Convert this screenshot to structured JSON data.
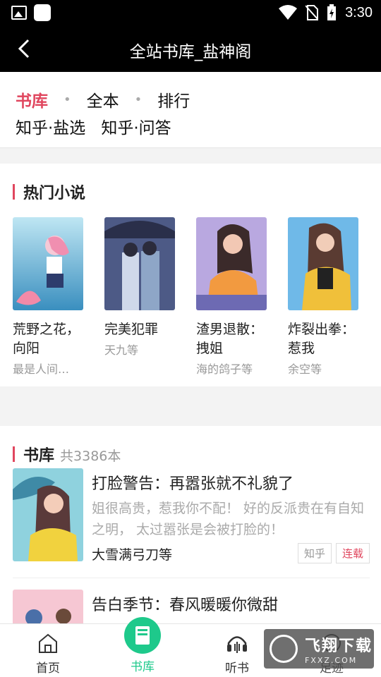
{
  "status_bar": {
    "time": "3:30",
    "icons": [
      "image-icon",
      "app-icon",
      "wifi-icon",
      "no-sim-icon",
      "battery-charging-icon"
    ]
  },
  "header": {
    "title": "全站书库_盐神阁",
    "back_icon": "chevron-left-icon"
  },
  "categories": {
    "row1": [
      "书库",
      "全本",
      "排行"
    ],
    "row2": [
      "知乎·盐选",
      "知乎·问答"
    ],
    "active": "书库",
    "accent": "#e0465e"
  },
  "hot": {
    "title": "热门小说",
    "items": [
      {
        "name": "荒野之花，向阳",
        "author": "最是人间…"
      },
      {
        "name": "完美犯罪",
        "author": "天九等"
      },
      {
        "name": "渣男退散：拽姐",
        "author": "海的鸽子等"
      },
      {
        "name": "炸裂出拳：惹我",
        "author": "余空等"
      }
    ]
  },
  "library": {
    "title": "书库",
    "count": "共3386本",
    "books": [
      {
        "title": "打脸警告：再嚣张就不礼貌了",
        "desc": "姐很高贵，惹我你不配！ 好的反派贵在有自知之明， 太过嚣张是会被打脸的！",
        "author": "大雪满弓刀等",
        "tags": [
          "知乎",
          "连载"
        ]
      },
      {
        "title": "告白季节：春风暖暖你微甜",
        "desc": "",
        "author": "",
        "tags": []
      }
    ]
  },
  "tabs": [
    {
      "label": "首页",
      "icon": "home-icon"
    },
    {
      "label": "书库",
      "icon": "book-icon"
    },
    {
      "label": "听书",
      "icon": "headphones-icon"
    },
    {
      "label": "足迹",
      "icon": "history-icon"
    }
  ],
  "watermark": {
    "text": "飞翔下载",
    "sub": "FXXZ.COM"
  },
  "colors": {
    "accent": "#e0465e",
    "green": "#1ec98b",
    "header": "#000000"
  }
}
